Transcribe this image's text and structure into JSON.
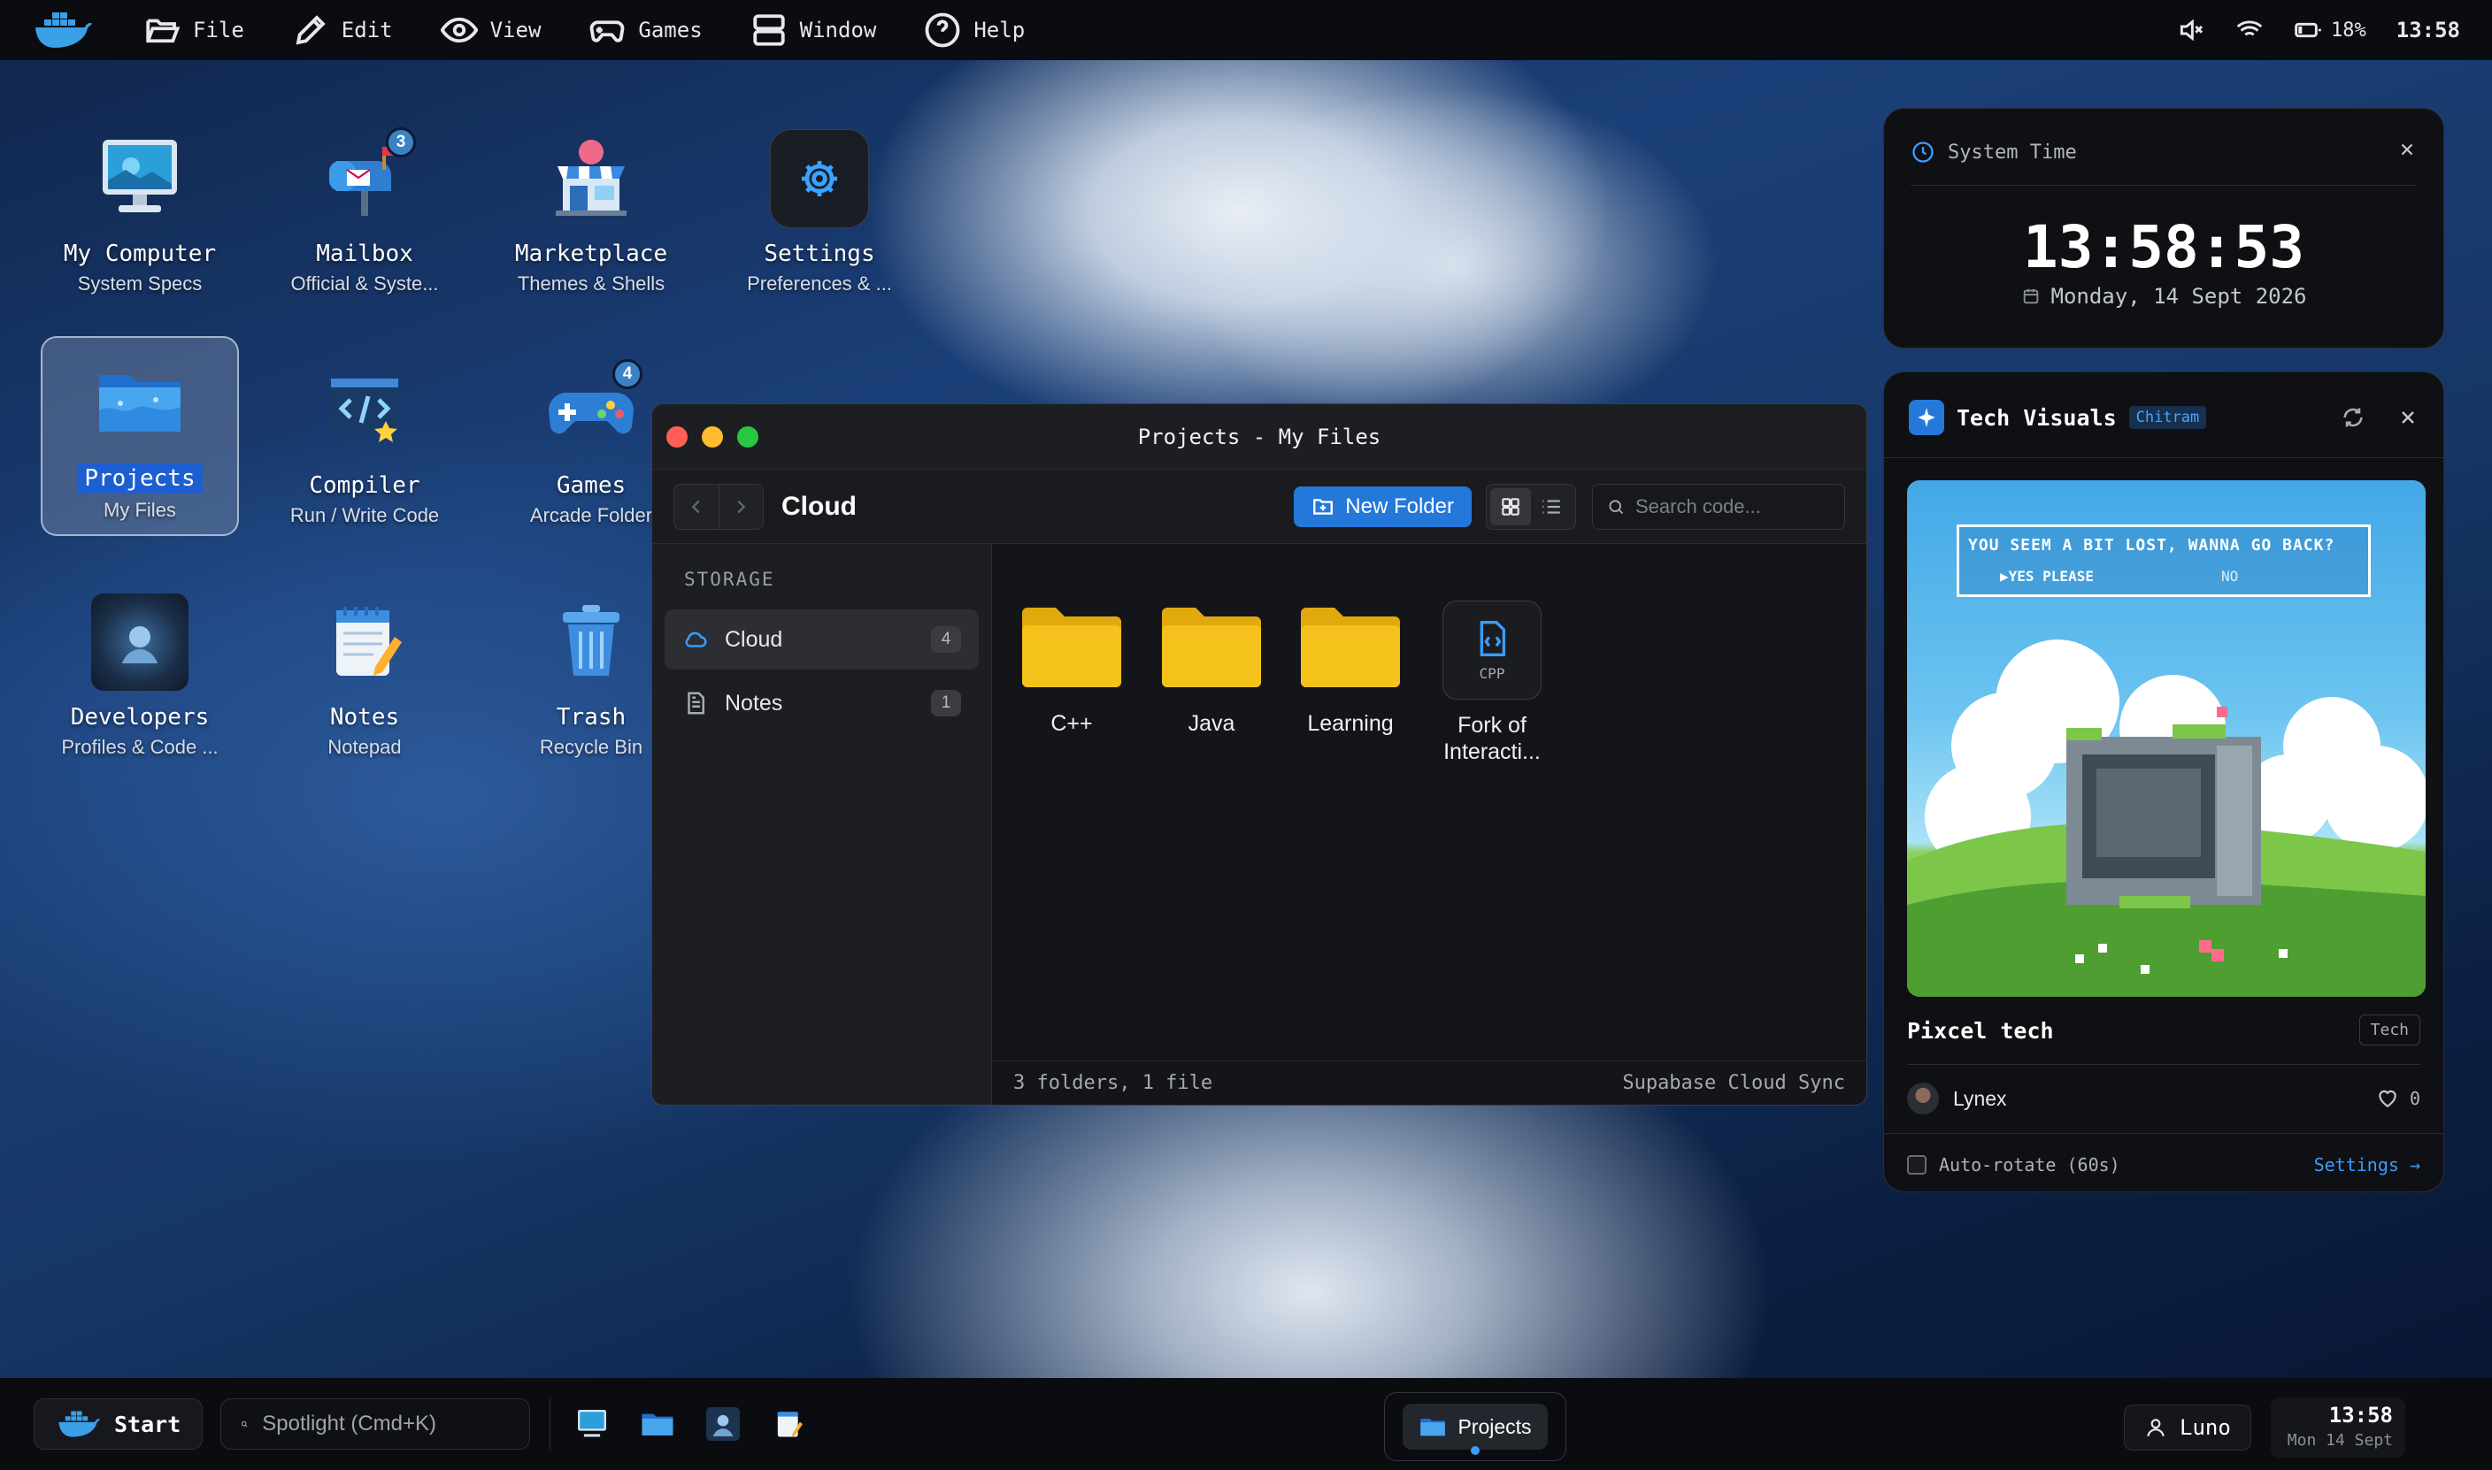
{
  "menubar": {
    "items": [
      "File",
      "Edit",
      "View",
      "Games",
      "Window",
      "Help"
    ],
    "battery": "18%",
    "time": "13:58"
  },
  "desktop": {
    "icons": [
      {
        "title": "My Computer",
        "subtitle": "System Specs"
      },
      {
        "title": "Mailbox",
        "subtitle": "Official & Syste...",
        "badge": "3"
      },
      {
        "title": "Marketplace",
        "subtitle": "Themes & Shells"
      },
      {
        "title": "Settings",
        "subtitle": "Preferences & ..."
      },
      {
        "title": "Projects",
        "subtitle": "My Files"
      },
      {
        "title": "Compiler",
        "subtitle": "Run / Write Code"
      },
      {
        "title": "Games",
        "subtitle": "Arcade Folder",
        "badge": "4"
      },
      {
        "title": "Developers",
        "subtitle": "Profiles & Code ..."
      },
      {
        "title": "Notes",
        "subtitle": "Notepad"
      },
      {
        "title": "Trash",
        "subtitle": "Recycle Bin"
      }
    ]
  },
  "window": {
    "title": "Projects - My Files",
    "location": "Cloud",
    "new_folder_label": "New Folder",
    "search_placeholder": "Search code...",
    "sidebar": {
      "header": "STORAGE",
      "items": [
        {
          "label": "Cloud",
          "count": "4"
        },
        {
          "label": "Notes",
          "count": "1"
        }
      ]
    },
    "files": [
      {
        "name": "C++",
        "type": "folder"
      },
      {
        "name": "Java",
        "type": "folder"
      },
      {
        "name": "Learning",
        "type": "folder"
      },
      {
        "name": "Fork of Interacti...",
        "type": "file",
        "ext": "CPP"
      }
    ],
    "status_left": "3 folders, 1 file",
    "status_right": "Supabase Cloud Sync"
  },
  "time_widget": {
    "title": "System Time",
    "clock": "13:58:53",
    "date": "Monday, 14 Sept 2026"
  },
  "tech_widget": {
    "title": "Tech Visuals",
    "tag": "Chitram",
    "pixel_text_1": "YOU SEEM A BIT LOST, WANNA GO BACK?",
    "pixel_text_2": "▶YES PLEASE",
    "pixel_text_3": "NO",
    "post_title": "Pixcel tech",
    "post_tag": "Tech",
    "author": "Lynex",
    "likes": "0",
    "auto_rotate": "Auto-rotate (60s)",
    "settings_link": "Settings →"
  },
  "taskbar": {
    "start_label": "Start",
    "spotlight_placeholder": "Spotlight (Cmd+K)",
    "active_app": "Projects",
    "user": "Luno",
    "time": "13:58",
    "date": "Mon 14 Sept"
  },
  "colors": {
    "accent": "#2478d9",
    "folder": "#f5c21b",
    "badge": "#3b82c4"
  }
}
